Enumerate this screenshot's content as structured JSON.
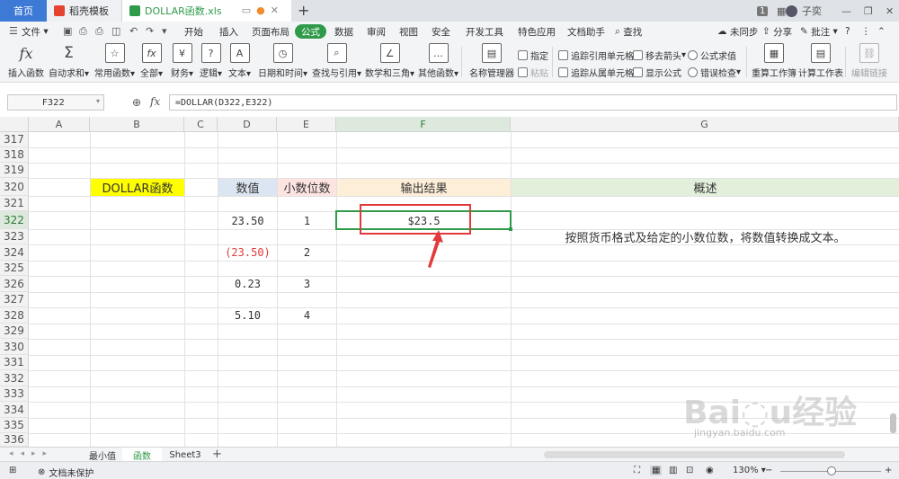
{
  "tabs": {
    "home": "首页",
    "template": "稻壳模板",
    "file": "DOLLAR函数.xls",
    "add": "+"
  },
  "window": {
    "page_num": "1",
    "user": "子奕",
    "minimize": "—",
    "restore": "❐",
    "close": "✕"
  },
  "menu": {
    "file": "文件",
    "items": [
      "开始",
      "插入",
      "页面布局",
      "公式",
      "数据",
      "审阅",
      "视图",
      "安全",
      "开发工具",
      "特色应用",
      "文档助手"
    ],
    "active": "公式",
    "search": "查找",
    "sync": "未同步",
    "share": "分享",
    "comment": "批注"
  },
  "ribbon": {
    "insert_fn": "插入函数",
    "autosum": "自动求和",
    "common_fn": "常用函数",
    "all": "全部",
    "finance": "财务",
    "logic": "逻辑",
    "text": "文本",
    "datetime": "日期和时间",
    "lookup": "查找与引用",
    "math": "数学和三角",
    "other_fn": "其他函数",
    "name_mgr": "名称管理器",
    "specify": "指定",
    "paste": "粘贴",
    "trace_prec": "追踪引用单元格",
    "trace_dep": "追踪从属单元格",
    "remove_arrows": "移去箭头",
    "show_formula": "显示公式",
    "eval_formula": "公式求值",
    "error_check": "错误检查",
    "recalc_book": "重算工作簿",
    "calc_sheet": "计算工作表",
    "edit_links": "编辑链接"
  },
  "formula_bar": {
    "name_box": "F322",
    "fx": "fx",
    "formula": "=DOLLAR(D322,E322)"
  },
  "columns": [
    "A",
    "B",
    "C",
    "D",
    "E",
    "F",
    "G"
  ],
  "rows": [
    "317",
    "318",
    "319",
    "320",
    "321",
    "322",
    "323",
    "324",
    "325",
    "326",
    "327",
    "328",
    "329",
    "330",
    "331",
    "332",
    "333",
    "334",
    "335",
    "336"
  ],
  "cells": {
    "b320": "DOLLAR函数",
    "d320": "数值",
    "e320": "小数位数",
    "f320": "输出结果",
    "g320": "概述",
    "d322": "23.50",
    "e322": "1",
    "f322": "$23.5",
    "g323": "按照货币格式及给定的小数位数，将数值转换成文本。",
    "d324": "(23.50)",
    "e324": "2",
    "d326": "0.23",
    "e326": "3",
    "d328": "5.10",
    "e328": "4"
  },
  "sheets": [
    "最小值",
    "函数",
    "Sheet3"
  ],
  "active_sheet": "函数",
  "status": {
    "protect": "文档未保护",
    "zoom": "130%"
  },
  "watermark": "Baidu经验 jingyan.baidu.com",
  "colors": {
    "accent_green": "#2f9a4a",
    "tab_blue": "#3d7ad6",
    "yellow": "#ffff00",
    "light_blue": "#dce6f2",
    "pink": "#fde4e1",
    "orange_light": "#fdeed8",
    "green_light": "#e2efdb",
    "red": "#e23a3a"
  }
}
